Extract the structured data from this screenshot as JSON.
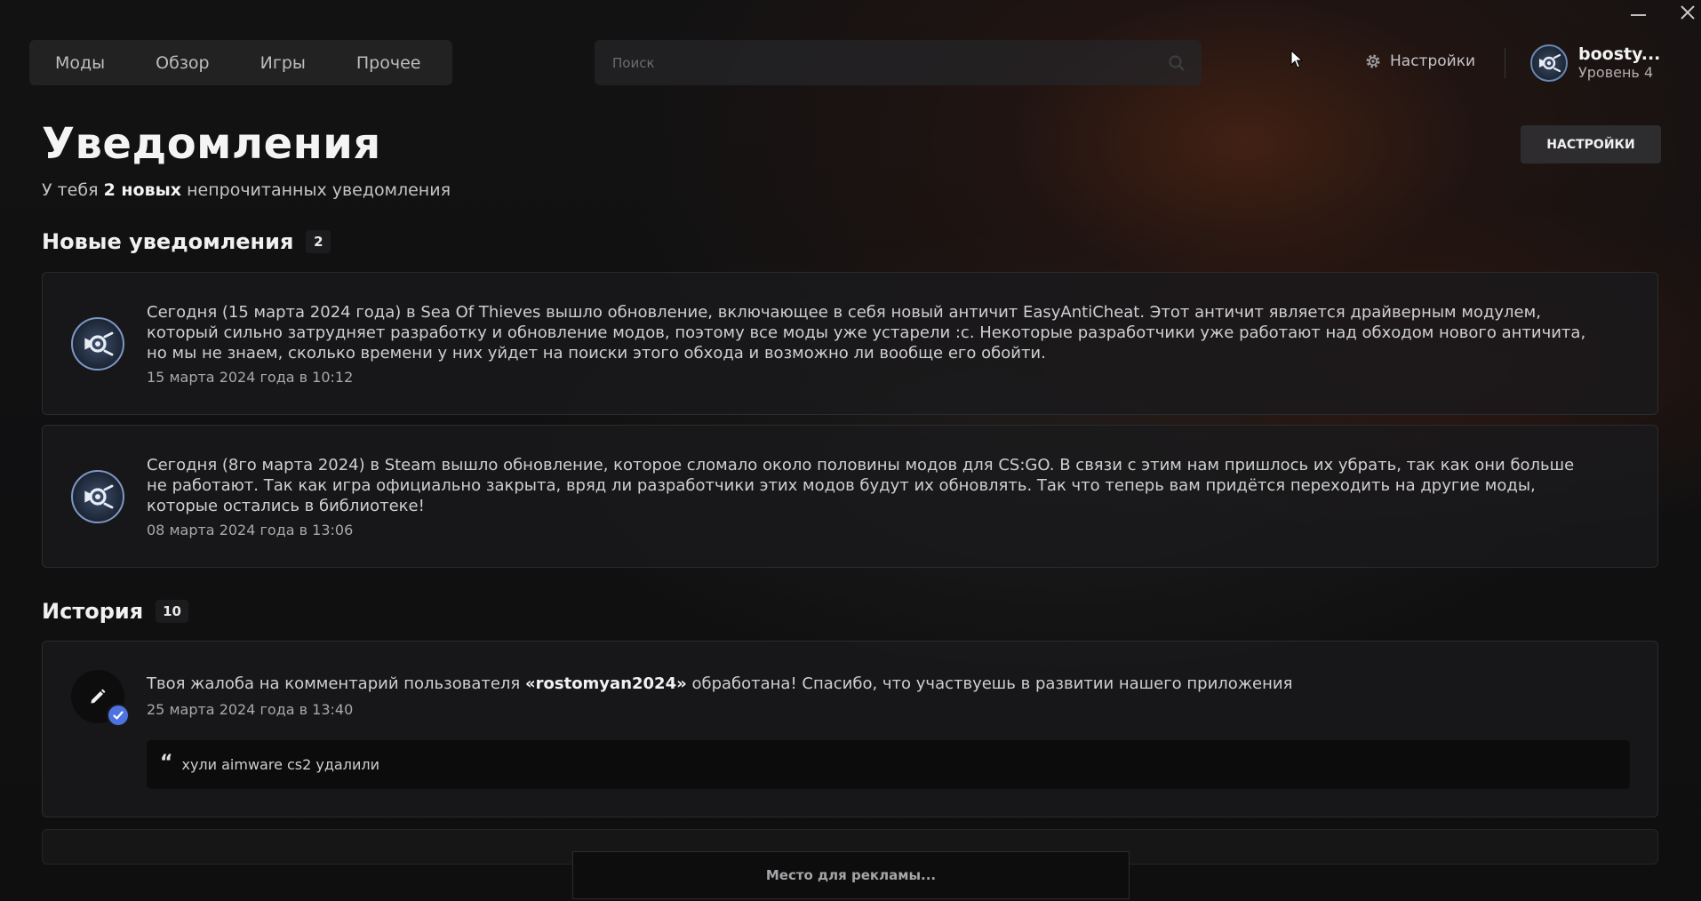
{
  "nav": {
    "items": [
      {
        "label": "Моды"
      },
      {
        "label": "Обзор"
      },
      {
        "label": "Игры"
      },
      {
        "label": "Прочее"
      }
    ]
  },
  "search": {
    "placeholder": "Поиск",
    "value": ""
  },
  "topbar": {
    "settings_label": "Настройки",
    "profile_name": "boosty...",
    "profile_level": "Уровень 4"
  },
  "header": {
    "title": "Уведомления",
    "subtitle_prefix": "У тебя",
    "subtitle_count": "2 новых",
    "subtitle_suffix": "непрочитанных уведомления",
    "settings_button": "НАСТРОЙКИ"
  },
  "new_section": {
    "title": "Новые уведомления",
    "count": "2",
    "items": [
      {
        "text": "Сегодня (15 марта 2024 года) в Sea Of Thieves вышло обновление, включающее в себя новый античит EasyAntiCheat. Этот античит является драйверным модулем, который сильно затрудняет разработку и обновление модов, поэтому все моды уже устарели :c. Некоторые разработчики уже работают над обходом нового античита, но мы не знаем, сколько времени у них уйдет на поиски этого обхода и возможно ли вообще его обойти.",
        "date": "15 марта 2024 года в 10:12"
      },
      {
        "text": "Сегодня (8го марта 2024) в Steam вышло обновление, которое сломало около половины модов для CS:GO. В связи с этим нам пришлось их убрать, так как они больше не работают. Так как игра официально закрыта, вряд ли разработчики этих модов будут их обновлять. Так что теперь вам придётся переходить на другие моды, которые остались в библиотеке!",
        "date": "08 марта 2024 года в 13:06"
      }
    ]
  },
  "history_section": {
    "title": "История",
    "count": "10",
    "items": [
      {
        "text_prefix": "Твоя жалоба на комментарий пользователя",
        "text_user": "«rostomyan2024»",
        "text_suffix": "обработана! Спасибо, что участвуешь в развитии нашего приложения",
        "date": "25 марта 2024 года в 13:40",
        "quote": "хули aimware cs2 удалили"
      }
    ]
  },
  "ad": {
    "label": "Место для рекламы..."
  },
  "icons": {
    "search": "search-icon",
    "settings": "gear-icon",
    "avatar": "mod-logo-icon",
    "history": "pencil-icon",
    "status": "check-icon",
    "quote": "quote-icon"
  },
  "colors": {
    "accent": "#4d73e0",
    "avatar_ring": "#7c98c4"
  }
}
